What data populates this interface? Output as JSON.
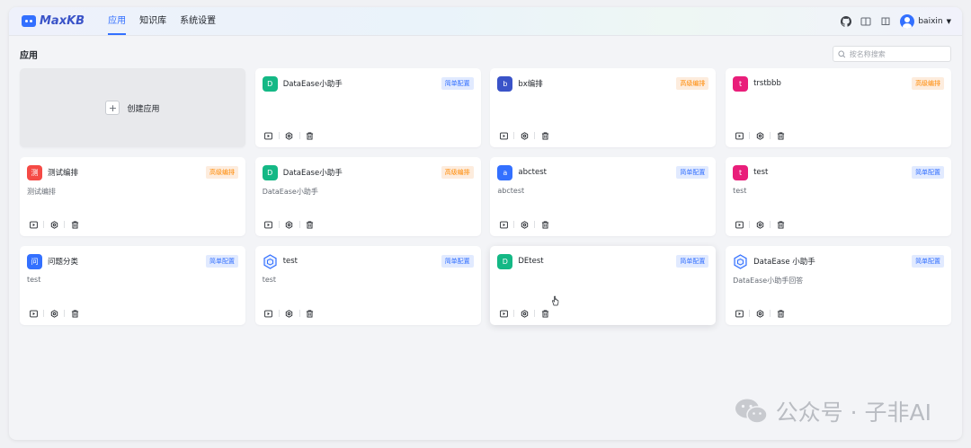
{
  "logo": {
    "text": "MaxKB"
  },
  "nav": {
    "items": [
      {
        "label": "应用"
      },
      {
        "label": "知识库"
      },
      {
        "label": "系统设置"
      }
    ]
  },
  "user": {
    "name": "baixin"
  },
  "page": {
    "title": "应用"
  },
  "search": {
    "placeholder": "按名称搜索"
  },
  "create": {
    "label": "创建应用"
  },
  "apps": [
    {
      "icon_text": "D",
      "icon_color": "#14b885",
      "name": "DataEase小助手",
      "tag": "简单配置",
      "desc": ""
    },
    {
      "icon_text": "b",
      "icon_color": "#3a53c8",
      "name": "bx编排",
      "tag": "高级编排",
      "desc": ""
    },
    {
      "icon_text": "t",
      "icon_color": "#e91e7a",
      "name": "trstbbb",
      "tag": "高级编排",
      "desc": ""
    },
    {
      "icon_text": "测",
      "icon_color": "#f54a45",
      "name": "测试编排",
      "tag": "高级编排",
      "desc": "测试编排"
    },
    {
      "icon_text": "D",
      "icon_color": "#14b885",
      "name": "DataEase小助手",
      "tag": "高级编排",
      "desc": "DataEase小助手"
    },
    {
      "icon_text": "a",
      "icon_color": "#3370ff",
      "name": "abctest",
      "tag": "简单配置",
      "desc": "abctest"
    },
    {
      "icon_text": "t",
      "icon_color": "#e91e7a",
      "name": "test",
      "tag": "简单配置",
      "desc": "test"
    },
    {
      "icon_text": "问",
      "icon_color": "#3370ff",
      "name": "问题分类",
      "tag": "简单配置",
      "desc": "test"
    },
    {
      "icon_text": "",
      "icon_color": "#3370ff",
      "name": "test",
      "tag": "简单配置",
      "desc": "test"
    },
    {
      "icon_text": "D",
      "icon_color": "#14b885",
      "name": "DEtest",
      "tag": "简单配置",
      "desc": ""
    },
    {
      "icon_text": "",
      "icon_color": "#3370ff",
      "name": "DataEase 小助手",
      "tag": "简单配置",
      "desc": "DataEase小助手回答"
    }
  ],
  "watermark": {
    "text": "公众号 · 子非AI"
  },
  "colors": {
    "accent": "#3370ff",
    "simple_tag_bg": "#e1eaff",
    "advanced_tag_bg": "#fdecdd",
    "advanced_tag_fg": "#ff8800"
  }
}
